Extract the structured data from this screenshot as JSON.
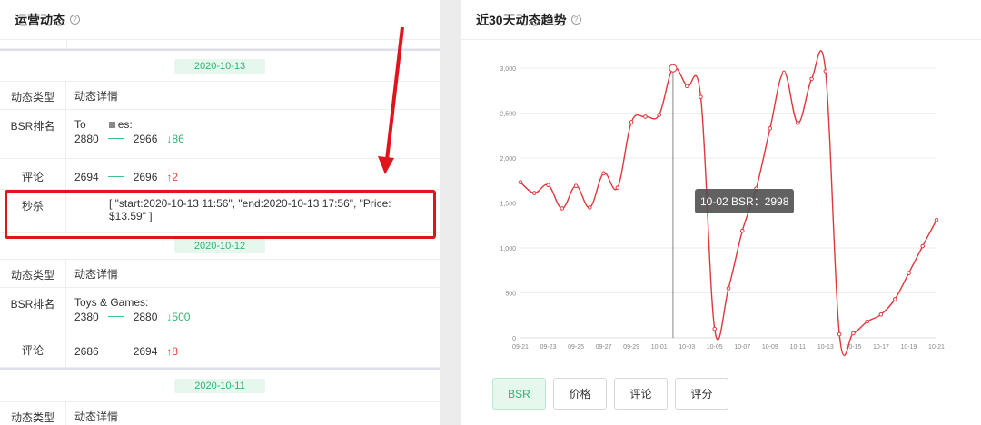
{
  "left_panel": {
    "title": "运营动态",
    "groups": [
      {
        "date": "2020-10-13",
        "header": {
          "type": "动态类型",
          "detail": "动态详情"
        },
        "bsr": {
          "label": "BSR排名",
          "category_visible": "To",
          "category_tail": "es:",
          "from": "2880",
          "to": "2966",
          "change": "86",
          "direction": "down"
        },
        "review": {
          "label": "评论",
          "from": "2694",
          "to": "2696",
          "change": "2",
          "direction": "up"
        },
        "seckill": {
          "label": "秒杀",
          "detail": "[ \"start:2020-10-13 11:56\", \"end:2020-10-13 17:56\", \"Price: $13.59\" ]"
        }
      },
      {
        "date": "2020-10-12",
        "header": {
          "type": "动态类型",
          "detail": "动态详情"
        },
        "bsr": {
          "label": "BSR排名",
          "category": "Toys & Games:",
          "from": "2380",
          "to": "2880",
          "change": "500",
          "direction": "down"
        },
        "review": {
          "label": "评论",
          "from": "2686",
          "to": "2694",
          "change": "8",
          "direction": "up"
        }
      },
      {
        "date": "2020-10-11",
        "header": {
          "type": "动态类型",
          "detail": "动态详情"
        }
      }
    ]
  },
  "right_panel": {
    "title": "近30天动态趋势",
    "tooltip": "10-02 BSR：2998",
    "tabs": [
      "BSR",
      "价格",
      "评论",
      "评分"
    ],
    "active_tab": "BSR"
  },
  "colors": {
    "accent_green": "#2db470",
    "line_red": "#e0373d",
    "annotation_red": "#e0141c"
  },
  "chart_data": {
    "type": "line",
    "title": "",
    "series": [
      {
        "name": "BSR",
        "x": [
          "09-21",
          "09-22",
          "09-23",
          "09-24",
          "09-25",
          "09-26",
          "09-27",
          "09-28",
          "09-29",
          "09-30",
          "10-01",
          "10-02",
          "10-03",
          "10-04",
          "10-05",
          "10-06",
          "10-07",
          "10-08",
          "10-09",
          "10-10",
          "10-11",
          "10-12",
          "10-13",
          "10-14",
          "10-15",
          "10-16",
          "10-17",
          "10-18",
          "10-19",
          "10-20",
          "10-21"
        ],
        "values": [
          1730,
          1610,
          1700,
          1440,
          1690,
          1450,
          1830,
          1670,
          2400,
          2460,
          2480,
          2998,
          2800,
          2680,
          100,
          550,
          1190,
          1660,
          2330,
          2950,
          2390,
          2880,
          2966,
          40,
          50,
          180,
          260,
          430,
          720,
          1020,
          1310
        ]
      }
    ],
    "xticks": [
      "09-21",
      "09-23",
      "09-25",
      "09-27",
      "09-29",
      "10-01",
      "10-03",
      "10-05",
      "10-07",
      "10-09",
      "10-11",
      "10-13",
      "10-15",
      "10-17",
      "10-19",
      "10-21"
    ],
    "yticks": [
      "0",
      "500",
      "1,000",
      "1,500",
      "2,000",
      "2,500",
      "3,000"
    ],
    "ylim": [
      0,
      3000
    ],
    "highlight_x": "10-02",
    "grid": true
  }
}
